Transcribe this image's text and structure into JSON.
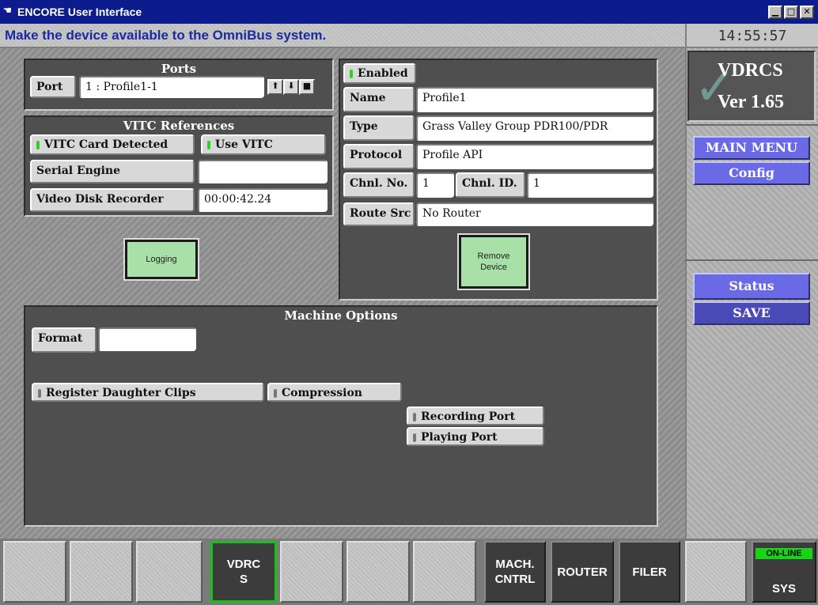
{
  "window": {
    "title": "ENCORE User Interface"
  },
  "message": "Make the device available to the OmniBus system.",
  "clock": "14:55:57",
  "ports": {
    "title": "Ports",
    "port_label": "Port",
    "port_value": "1 : Profile1-1"
  },
  "vitc": {
    "title": "VITC References",
    "card_detected": "VITC Card Detected",
    "use_vitc": "Use VITC",
    "serial_engine_label": "Serial Engine",
    "serial_engine_value": "",
    "vdr_label": "Video Disk Recorder",
    "vdr_value": "00:00:42.24"
  },
  "logging_button": "Logging",
  "device": {
    "enabled": "Enabled",
    "name_label": "Name",
    "name_value": "Profile1",
    "type_label": "Type",
    "type_value": "Grass Valley Group PDR100/PDR",
    "protocol_label": "Protocol",
    "protocol_value": "Profile API",
    "chnl_no_label": "Chnl. No.",
    "chnl_no_value": "1",
    "chnl_id_label": "Chnl. ID.",
    "chnl_id_value": "1",
    "route_label": "Route Src",
    "route_value": "No Router",
    "remove_line1": "Remove",
    "remove_line2": "Device"
  },
  "machine": {
    "title": "Machine Options",
    "format_label": "Format",
    "format_value": "",
    "register_daughter": "Register Daughter Clips",
    "compression": "Compression",
    "recording_port": "Recording Port",
    "playing_port": "Playing Port"
  },
  "sidebar": {
    "logo_line1": "VDRCS",
    "logo_line2": "Ver 1.65",
    "main_menu": "MAIN MENU",
    "config": "Config",
    "status": "Status",
    "save": "SAVE"
  },
  "bottom": {
    "vdrcs_line1": "VDRC",
    "vdrcs_line2": "S",
    "mach_line1": "MACH.",
    "mach_line2": "CNTRL",
    "router": "ROUTER",
    "filer": "FILER",
    "online": "ON-LINE",
    "sys": "SYS"
  },
  "colors": {
    "title_bar": "#0c1c8c",
    "message_text": "#1a2aa0",
    "menu_button": "#6a6ae6",
    "save_button": "#4a4ab8",
    "online": "#14d614",
    "selected_outline": "#18c018",
    "action_button": "#a8e0a8"
  }
}
